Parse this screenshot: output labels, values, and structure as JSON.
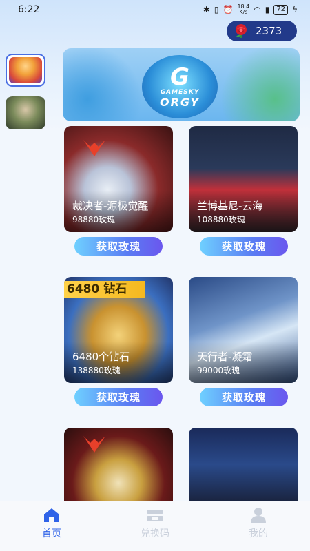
{
  "status_bar": {
    "time": "6:22",
    "net_speed_value": "18.4",
    "net_speed_unit": "K/s",
    "battery": "72"
  },
  "roses": {
    "count": "2373",
    "icon": "rose-icon"
  },
  "sidebar": {
    "games": [
      {
        "name": "game-tab-qq-speed",
        "active": true
      },
      {
        "name": "game-tab-second-game",
        "active": false
      }
    ]
  },
  "banner": {
    "logo_letter": "G",
    "logo_line1": "GAMESKY",
    "logo_line2": "ORGY"
  },
  "cards": [
    {
      "title": "裁决者-源极觉醒",
      "price": "98880玫瑰",
      "button": "获取玫瑰"
    },
    {
      "title": "兰博基尼-云海",
      "price": "108880玫瑰",
      "button": "获取玫瑰"
    },
    {
      "title": "6480个钻石",
      "price": "138880玫瑰",
      "button": "获取玫瑰",
      "badge": "6480 钻石"
    },
    {
      "title": "天行者-凝霜",
      "price": "99000玫瑰",
      "button": "获取玫瑰"
    },
    {
      "title": "",
      "price": ""
    },
    {
      "title": "",
      "price": ""
    }
  ],
  "tabbar": {
    "items": [
      {
        "label": "首页",
        "icon": "home-icon",
        "active": true
      },
      {
        "label": "兑换码",
        "icon": "ticket-icon",
        "active": false
      },
      {
        "label": "我的",
        "icon": "user-icon",
        "active": false
      }
    ]
  },
  "colors": {
    "accent": "#2f63e8",
    "pill_bg": "#223a8a",
    "tab_inactive": "#c9d0db"
  }
}
